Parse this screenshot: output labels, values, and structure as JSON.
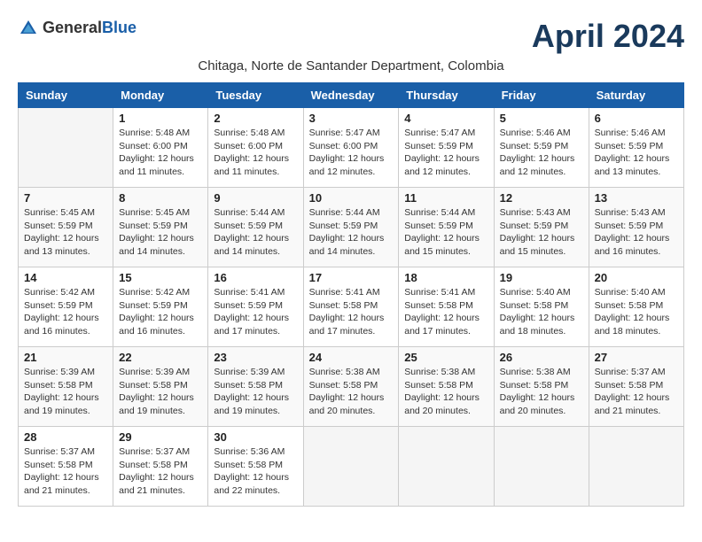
{
  "header": {
    "logo_general": "General",
    "logo_blue": "Blue",
    "month_title": "April 2024",
    "subtitle": "Chitaga, Norte de Santander Department, Colombia"
  },
  "weekdays": [
    "Sunday",
    "Monday",
    "Tuesday",
    "Wednesday",
    "Thursday",
    "Friday",
    "Saturday"
  ],
  "weeks": [
    [
      {
        "day": "",
        "info": ""
      },
      {
        "day": "1",
        "info": "Sunrise: 5:48 AM\nSunset: 6:00 PM\nDaylight: 12 hours and 11 minutes."
      },
      {
        "day": "2",
        "info": "Sunrise: 5:48 AM\nSunset: 6:00 PM\nDaylight: 12 hours and 11 minutes."
      },
      {
        "day": "3",
        "info": "Sunrise: 5:47 AM\nSunset: 6:00 PM\nDaylight: 12 hours and 12 minutes."
      },
      {
        "day": "4",
        "info": "Sunrise: 5:47 AM\nSunset: 5:59 PM\nDaylight: 12 hours and 12 minutes."
      },
      {
        "day": "5",
        "info": "Sunrise: 5:46 AM\nSunset: 5:59 PM\nDaylight: 12 hours and 12 minutes."
      },
      {
        "day": "6",
        "info": "Sunrise: 5:46 AM\nSunset: 5:59 PM\nDaylight: 12 hours and 13 minutes."
      }
    ],
    [
      {
        "day": "7",
        "info": "Sunrise: 5:45 AM\nSunset: 5:59 PM\nDaylight: 12 hours and 13 minutes."
      },
      {
        "day": "8",
        "info": "Sunrise: 5:45 AM\nSunset: 5:59 PM\nDaylight: 12 hours and 14 minutes."
      },
      {
        "day": "9",
        "info": "Sunrise: 5:44 AM\nSunset: 5:59 PM\nDaylight: 12 hours and 14 minutes."
      },
      {
        "day": "10",
        "info": "Sunrise: 5:44 AM\nSunset: 5:59 PM\nDaylight: 12 hours and 14 minutes."
      },
      {
        "day": "11",
        "info": "Sunrise: 5:44 AM\nSunset: 5:59 PM\nDaylight: 12 hours and 15 minutes."
      },
      {
        "day": "12",
        "info": "Sunrise: 5:43 AM\nSunset: 5:59 PM\nDaylight: 12 hours and 15 minutes."
      },
      {
        "day": "13",
        "info": "Sunrise: 5:43 AM\nSunset: 5:59 PM\nDaylight: 12 hours and 16 minutes."
      }
    ],
    [
      {
        "day": "14",
        "info": "Sunrise: 5:42 AM\nSunset: 5:59 PM\nDaylight: 12 hours and 16 minutes."
      },
      {
        "day": "15",
        "info": "Sunrise: 5:42 AM\nSunset: 5:59 PM\nDaylight: 12 hours and 16 minutes."
      },
      {
        "day": "16",
        "info": "Sunrise: 5:41 AM\nSunset: 5:59 PM\nDaylight: 12 hours and 17 minutes."
      },
      {
        "day": "17",
        "info": "Sunrise: 5:41 AM\nSunset: 5:58 PM\nDaylight: 12 hours and 17 minutes."
      },
      {
        "day": "18",
        "info": "Sunrise: 5:41 AM\nSunset: 5:58 PM\nDaylight: 12 hours and 17 minutes."
      },
      {
        "day": "19",
        "info": "Sunrise: 5:40 AM\nSunset: 5:58 PM\nDaylight: 12 hours and 18 minutes."
      },
      {
        "day": "20",
        "info": "Sunrise: 5:40 AM\nSunset: 5:58 PM\nDaylight: 12 hours and 18 minutes."
      }
    ],
    [
      {
        "day": "21",
        "info": "Sunrise: 5:39 AM\nSunset: 5:58 PM\nDaylight: 12 hours and 19 minutes."
      },
      {
        "day": "22",
        "info": "Sunrise: 5:39 AM\nSunset: 5:58 PM\nDaylight: 12 hours and 19 minutes."
      },
      {
        "day": "23",
        "info": "Sunrise: 5:39 AM\nSunset: 5:58 PM\nDaylight: 12 hours and 19 minutes."
      },
      {
        "day": "24",
        "info": "Sunrise: 5:38 AM\nSunset: 5:58 PM\nDaylight: 12 hours and 20 minutes."
      },
      {
        "day": "25",
        "info": "Sunrise: 5:38 AM\nSunset: 5:58 PM\nDaylight: 12 hours and 20 minutes."
      },
      {
        "day": "26",
        "info": "Sunrise: 5:38 AM\nSunset: 5:58 PM\nDaylight: 12 hours and 20 minutes."
      },
      {
        "day": "27",
        "info": "Sunrise: 5:37 AM\nSunset: 5:58 PM\nDaylight: 12 hours and 21 minutes."
      }
    ],
    [
      {
        "day": "28",
        "info": "Sunrise: 5:37 AM\nSunset: 5:58 PM\nDaylight: 12 hours and 21 minutes."
      },
      {
        "day": "29",
        "info": "Sunrise: 5:37 AM\nSunset: 5:58 PM\nDaylight: 12 hours and 21 minutes."
      },
      {
        "day": "30",
        "info": "Sunrise: 5:36 AM\nSunset: 5:58 PM\nDaylight: 12 hours and 22 minutes."
      },
      {
        "day": "",
        "info": ""
      },
      {
        "day": "",
        "info": ""
      },
      {
        "day": "",
        "info": ""
      },
      {
        "day": "",
        "info": ""
      }
    ]
  ]
}
